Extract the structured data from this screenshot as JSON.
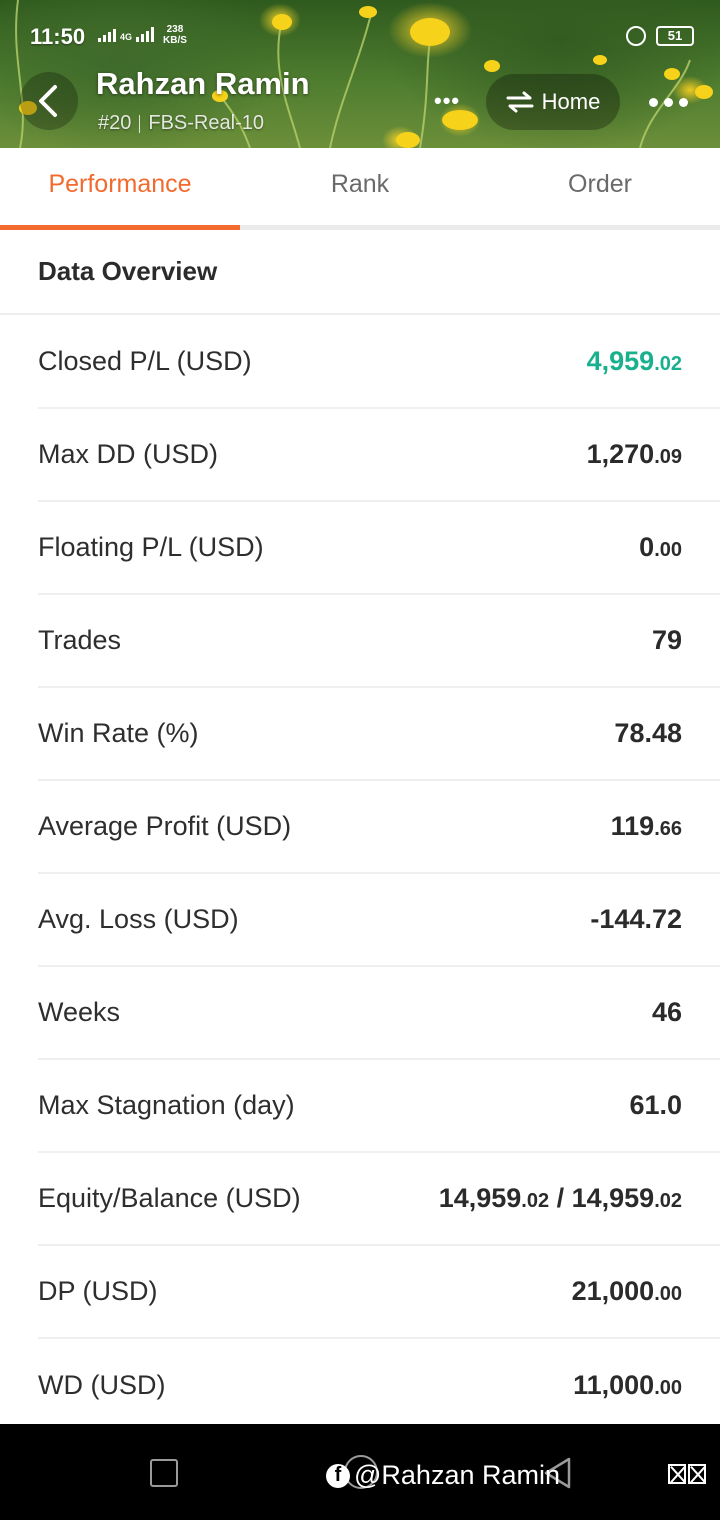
{
  "status_bar": {
    "time": "11:50",
    "network": "4G",
    "speed_value": "238",
    "speed_unit": "KB/S",
    "battery": "51"
  },
  "header": {
    "trader_name": "Rahzan Ramin",
    "rank": "#20",
    "account": "FBS-Real-10",
    "center_dots": "•••",
    "home_label": "Home"
  },
  "tabs": [
    {
      "label": "Performance",
      "active": true
    },
    {
      "label": "Rank",
      "active": false
    },
    {
      "label": "Order",
      "active": false
    }
  ],
  "section_title": "Data Overview",
  "rows": [
    {
      "label": "Closed P/L (USD)",
      "int": "4,959",
      "dec": ".02",
      "rest": "",
      "rest_dec": "",
      "positive": true
    },
    {
      "label": "Max DD (USD)",
      "int": "1,270",
      "dec": ".09",
      "rest": "",
      "rest_dec": "",
      "positive": false
    },
    {
      "label": "Floating P/L (USD)",
      "int": "0",
      "dec": ".00",
      "rest": "",
      "rest_dec": "",
      "positive": false
    },
    {
      "label": "Trades",
      "int": "79",
      "dec": "",
      "rest": "",
      "rest_dec": "",
      "positive": false
    },
    {
      "label": "Win Rate (%)",
      "int": "78.48",
      "dec": "",
      "rest": "",
      "rest_dec": "",
      "positive": false
    },
    {
      "label": "Average Profit (USD)",
      "int": "119",
      "dec": ".66",
      "rest": "",
      "rest_dec": "",
      "positive": false
    },
    {
      "label": "Avg. Loss (USD)",
      "int": "-144.72",
      "dec": "",
      "rest": "",
      "rest_dec": "",
      "positive": false
    },
    {
      "label": "Weeks",
      "int": "46",
      "dec": "",
      "rest": "",
      "rest_dec": "",
      "positive": false
    },
    {
      "label": "Max Stagnation (day)",
      "int": "61.0",
      "dec": "",
      "rest": "",
      "rest_dec": "",
      "positive": false
    },
    {
      "label": "Equity/Balance (USD)",
      "int": "14,959",
      "dec": ".02",
      "rest": " / 14,959",
      "rest_dec": ".02",
      "positive": false
    },
    {
      "label": "DP (USD)",
      "int": "21,000",
      "dec": ".00",
      "rest": "",
      "rest_dec": "",
      "positive": false
    },
    {
      "label": "WD (USD)",
      "int": "11,000",
      "dec": ".00",
      "rest": "",
      "rest_dec": "",
      "positive": false
    }
  ],
  "watermark": {
    "fb_letter": "f",
    "text": "@Rahzan Ramin"
  },
  "colors": {
    "accent": "#f26a2e",
    "positive": "#19b08e"
  }
}
